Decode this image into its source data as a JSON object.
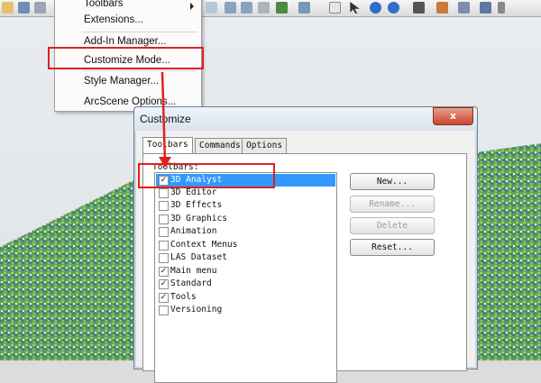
{
  "menu": {
    "items": [
      {
        "label": "Toolbars",
        "accel": "T",
        "submenu": true
      },
      {
        "label": "Extensions...",
        "accel": "E"
      },
      {
        "label": "Add-In Manager...",
        "accel": "d"
      },
      {
        "label": "Customize Mode...",
        "accel": "C",
        "highlighted": true
      },
      {
        "label": "Style Manager...",
        "accel": "M"
      },
      {
        "label": "ArcScene Options...",
        "accel": "n"
      }
    ]
  },
  "dialog": {
    "title": "Customize",
    "close_label": "x",
    "tabs": [
      {
        "label": "Toolbars",
        "active": true
      },
      {
        "label": "Commands",
        "active": false
      },
      {
        "label": "Options",
        "active": false
      }
    ],
    "list_label": "Toolbars:",
    "toolbars": [
      {
        "label": "3D Analyst",
        "checked": true,
        "selected": true
      },
      {
        "label": "3D Editor",
        "checked": false
      },
      {
        "label": "3D Effects",
        "checked": false
      },
      {
        "label": "3D Graphics",
        "checked": false
      },
      {
        "label": "Animation",
        "checked": false
      },
      {
        "label": "Context Menus",
        "checked": false
      },
      {
        "label": "LAS Dataset",
        "checked": false
      },
      {
        "label": "Main menu",
        "checked": true
      },
      {
        "label": "Standard",
        "checked": true
      },
      {
        "label": "Tools",
        "checked": true
      },
      {
        "label": "Versioning",
        "checked": false
      }
    ],
    "buttons": {
      "new": "New...",
      "rename": "Rename...",
      "delete": "Delete",
      "reset": "Reset..."
    }
  },
  "colors": {
    "annotation": "#e02020",
    "selection": "#3399ff"
  }
}
